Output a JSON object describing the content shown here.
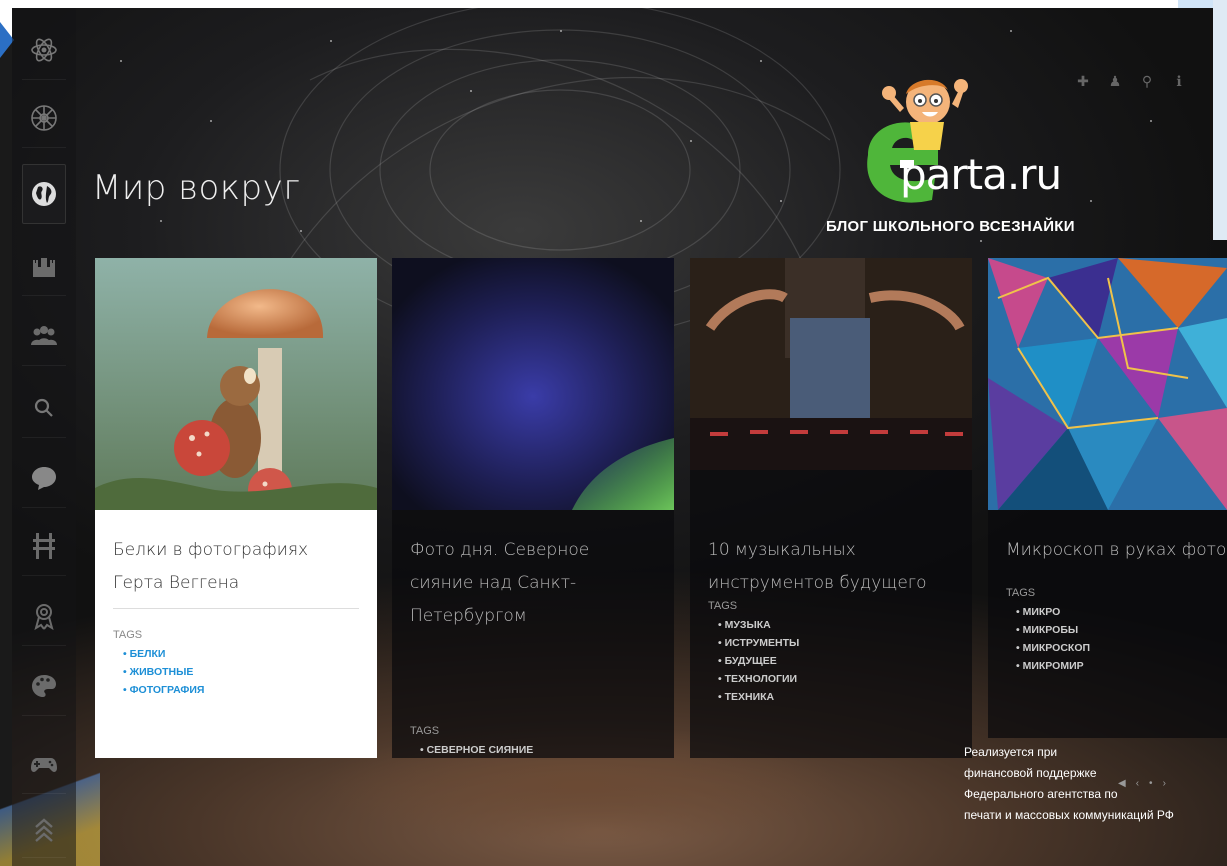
{
  "page": {
    "title": "Мир вокруг"
  },
  "logo": {
    "name": "parta.ru",
    "subtitle": "БЛОГ ШКОЛЬНОГО ВСЕЗНАЙКИ"
  },
  "sidebar": {
    "items": [
      {
        "icon": "atom-icon"
      },
      {
        "icon": "wheel-icon"
      },
      {
        "icon": "globe-icon",
        "active": true
      },
      {
        "icon": "castle-icon"
      },
      {
        "icon": "people-icon"
      },
      {
        "icon": "search-icon"
      },
      {
        "icon": "chat-icon"
      },
      {
        "icon": "railway-icon"
      },
      {
        "icon": "award-icon"
      },
      {
        "icon": "palette-icon"
      },
      {
        "icon": "gamepad-icon"
      },
      {
        "icon": "chevrons-up-icon"
      }
    ]
  },
  "top_icons": [
    "plus-icon",
    "user-icon",
    "search-icon",
    "info-icon"
  ],
  "cards": [
    {
      "title": "Белки в фотографиях Герта Веггена",
      "tags_label": "TAGS",
      "tags": [
        "белки",
        "животные",
        "фотография"
      ],
      "style": "light"
    },
    {
      "title": "Фото дня. Северное сияние над Санкт-Петербургом",
      "tags_label": "TAGS",
      "tags": [
        "северное сияние"
      ],
      "style": "dark"
    },
    {
      "title": "10 музыкальных инструментов будущего",
      "tags_label": "TAGS",
      "tags": [
        "музыка",
        "иструменты",
        "будущее",
        "технологии",
        "техника"
      ],
      "style": "dark"
    },
    {
      "title": "Микроскоп в руках фотографа Линдена Гледхилла",
      "tags_label": "TAGS",
      "tags": [
        "микро",
        "микробы",
        "микроскоп",
        "микромир"
      ],
      "style": "dark"
    }
  ],
  "footer": {
    "funding_lines": [
      "Реализуется при",
      "финансовой поддержке",
      "Федерального агентства по",
      "печати и массовых коммуникаций РФ"
    ]
  },
  "pager": [
    "◀",
    "‹",
    "•",
    "›"
  ]
}
